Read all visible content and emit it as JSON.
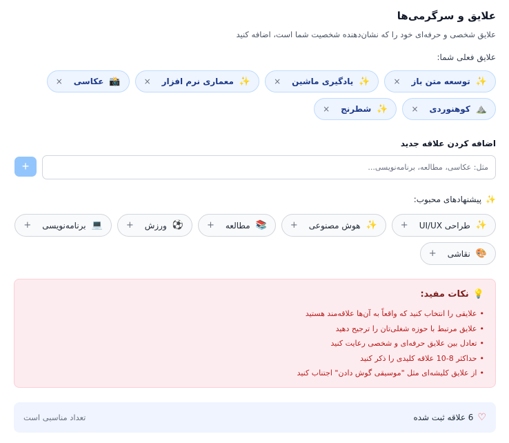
{
  "header": {
    "title": "علایق و سرگرمی‌ها",
    "subtitle": "علایق شخصی و حرفه‌ای خود را که نشان‌دهنده شخصیت شما است، اضافه کنید"
  },
  "current": {
    "label": "علایق فعلی شما:",
    "remove_glyph": "×",
    "items": [
      {
        "emoji": "✨",
        "label": "توسعه متن باز"
      },
      {
        "emoji": "✨",
        "label": "یادگیری ماشین"
      },
      {
        "emoji": "✨",
        "label": "معماری نرم افزار"
      },
      {
        "emoji": "📸",
        "label": "عکاسی"
      },
      {
        "emoji": "⛰️",
        "label": "کوهنوردی"
      },
      {
        "emoji": "✨",
        "label": "شطرنج"
      }
    ]
  },
  "add": {
    "label": "اضافه کردن علاقه جدید",
    "placeholder": "مثل: عکاسی، مطالعه، برنامه‌نویسی...",
    "value": "",
    "button_label": "+"
  },
  "suggestions": {
    "label": "پیشنهادهای محبوب:",
    "icon": "✨",
    "add_glyph": "+",
    "items": [
      {
        "emoji": "✨",
        "label": "طراحی UI/UX"
      },
      {
        "emoji": "✨",
        "label": "هوش مصنوعی"
      },
      {
        "emoji": "📚",
        "label": "مطالعه"
      },
      {
        "emoji": "⚽",
        "label": "ورزش"
      },
      {
        "emoji": "💻",
        "label": "برنامه‌نویسی"
      },
      {
        "emoji": "🎨",
        "label": "نقاشی"
      }
    ]
  },
  "tips": {
    "icon": "💡",
    "title": "نکات مفید:",
    "items": [
      "علایقی را انتخاب کنید که واقعاً به آن‌ها علاقه‌مند هستید",
      "علایق مرتبط با حوزه شغلی‌تان را ترجیح دهید",
      "تعادل بین علایق حرفه‌ای و شخصی رعایت کنید",
      "حداکثر 8-10 علاقه کلیدی را ذکر کنید",
      "از علایق کلیشه‌ای مثل \"موسیقی گوش دادن\" اجتناب کنید"
    ]
  },
  "status": {
    "icon": "♡",
    "count_text": "6 علاقه ثبت شده",
    "note": "تعداد مناسبی است"
  }
}
